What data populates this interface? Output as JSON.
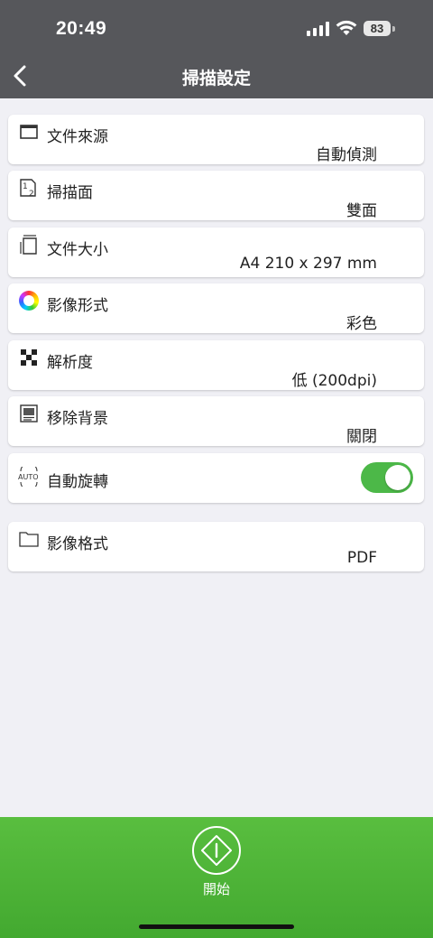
{
  "status_bar": {
    "time": "20:49",
    "battery": "83"
  },
  "header": {
    "title": "掃描設定"
  },
  "settings": [
    {
      "label": "文件來源",
      "value": "自動偵測"
    },
    {
      "label": "掃描面",
      "value": "雙面"
    },
    {
      "label": "文件大小",
      "value": "A4 210 x 297 mm"
    },
    {
      "label": "影像形式",
      "value": "彩色"
    },
    {
      "label": "解析度",
      "value": "低 (200dpi)"
    },
    {
      "label": "移除背景",
      "value": "關閉"
    }
  ],
  "auto_rotate": {
    "label": "自動旋轉",
    "icon_text": "AUTO",
    "enabled": true
  },
  "image_format": {
    "label": "影像格式",
    "value": "PDF"
  },
  "footer": {
    "start_label": "開始"
  },
  "colors": {
    "header": "#56575b",
    "accent": "#4cb848",
    "background": "#f0f0f5"
  }
}
